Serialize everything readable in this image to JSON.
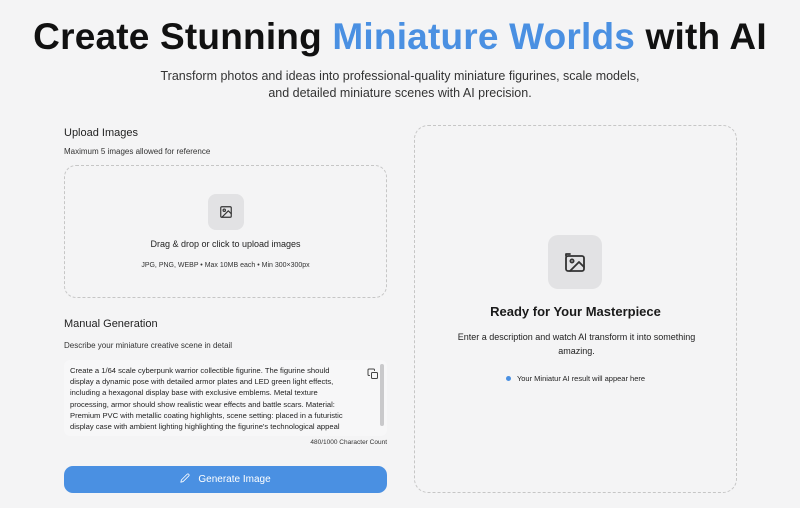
{
  "hero": {
    "title_part1": "Create Stunning ",
    "title_accent": "Miniature Worlds",
    "title_part2": " with AI",
    "subtitle": "Transform photos and ideas into professional-quality miniature figurines, scale models, and detailed miniature scenes with AI precision."
  },
  "upload": {
    "title": "Upload Images",
    "hint": "Maximum 5 images allowed for reference",
    "dropzone_main": "Drag & drop or click to upload images",
    "dropzone_sub": "JPG, PNG, WEBP • Max 10MB each • Min 300×300px",
    "icon": "image-icon"
  },
  "manual": {
    "title": "Manual Generation",
    "hint": "Describe your miniature creative scene in detail",
    "prompt_value": "Create a 1/64 scale cyberpunk warrior collectible figurine. The figurine should display a dynamic pose with detailed armor plates and LED green light effects, including a hexagonal display base with exclusive emblems. Metal texture processing, armor should show realistic wear effects and battle scars. Material: Premium PVC with metallic coating highlights, scene setting: placed in a futuristic display case with ambient lighting highlighting the figurine's technological appeal",
    "char_count": "480/1000 Character Count",
    "copy_icon": "copy-icon",
    "generate_label": "Generate Image",
    "generate_icon": "pencil-icon"
  },
  "result": {
    "title": "Ready for Your Masterpiece",
    "description": "Enter a description and watch AI transform it into something amazing.",
    "note": "Your Miniatur AI result will appear here",
    "icon": "image-placeholder-icon"
  },
  "colors": {
    "accent": "#4a90e2",
    "background": "#f4f4f5"
  }
}
